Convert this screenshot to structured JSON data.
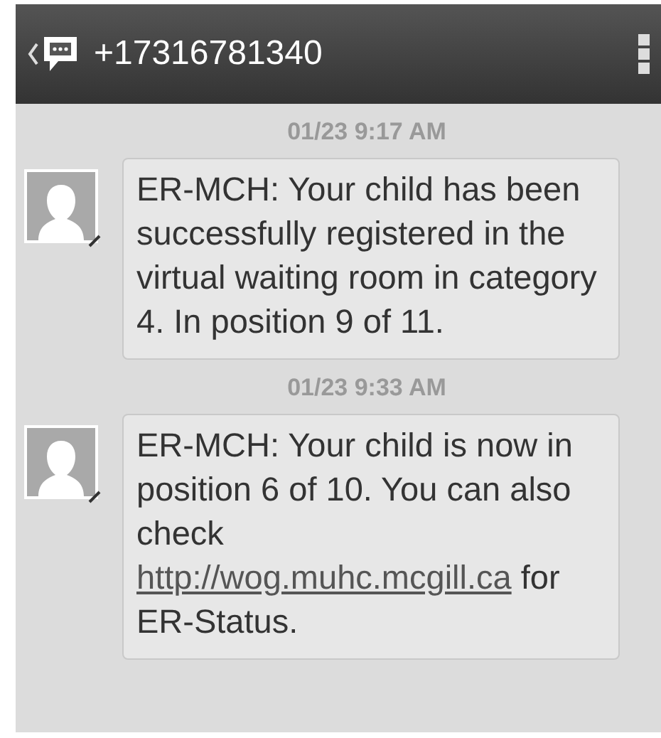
{
  "header": {
    "title": "+17316781340"
  },
  "messages": [
    {
      "timestamp": "01/23 9:17 AM",
      "text": "ER-MCH: Your child has been successfully registered in the virtual waiting room in category 4. In position 9 of 11."
    },
    {
      "timestamp": "01/23 9:33 AM",
      "text": "ER-MCH: Your child is now in position 6 of 10. You can also check",
      "link": "http://wog.muhc.mcgill.ca",
      "text_after": "for ER-Status."
    }
  ]
}
